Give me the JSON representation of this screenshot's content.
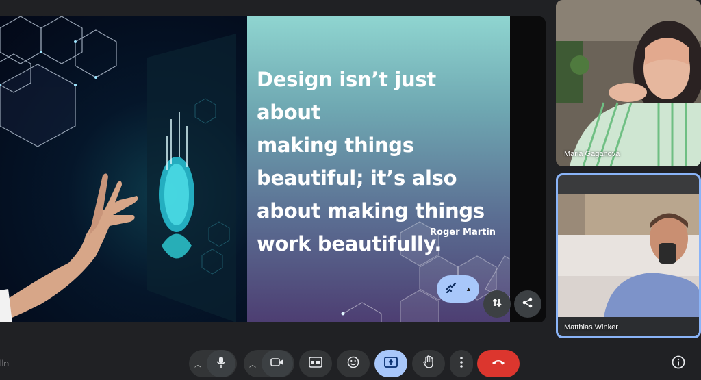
{
  "slide": {
    "quote_lines": [
      "Design isn’t just about",
      "making things",
      "beautiful; it’s also",
      "about making things",
      "work beautifully."
    ],
    "author": "Roger Martin"
  },
  "participants": [
    {
      "name": "Maria Gaganova"
    },
    {
      "name": "Matthias Winker"
    }
  ],
  "meeting": {
    "code_fragment": "lln"
  },
  "colors": {
    "background": "#202124",
    "accent_blue": "#a8c7fa",
    "end_call_red": "#dc362e",
    "active_speaker_outline": "#8ab4f8"
  },
  "icons": {
    "annotate": "annotate-icon",
    "swap": "swap-icon",
    "share": "share-icon",
    "mic": "mic-icon",
    "camera": "camera-icon",
    "captions": "captions-icon",
    "emoji": "emoji-icon",
    "present": "present-icon",
    "hand": "raise-hand-icon",
    "more": "more-options-icon",
    "end": "end-call-icon",
    "info": "info-icon"
  }
}
